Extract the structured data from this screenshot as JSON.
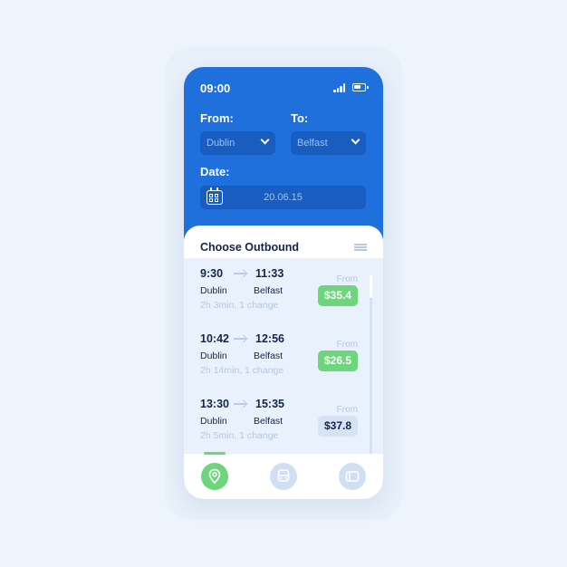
{
  "status_bar": {
    "time": "09:00"
  },
  "search": {
    "from_label": "From:",
    "from_value": "Dublin",
    "to_label": "To:",
    "to_value": "Belfast",
    "date_label": "Date:",
    "date_value": "20.06.15"
  },
  "results": {
    "title": "Choose Outbound",
    "trips": [
      {
        "depart": "9:30",
        "arrive": "11:33",
        "from": "Dublin",
        "to": "Belfast",
        "duration": "2h 3min, 1 change",
        "from_label": "From",
        "price": "$35.4",
        "style": "green"
      },
      {
        "depart": "10:42",
        "arrive": "12:56",
        "from": "Dublin",
        "to": "Belfast",
        "duration": "2h 14min, 1 change",
        "from_label": "From",
        "price": "$26.5",
        "style": "green"
      },
      {
        "depart": "13:30",
        "arrive": "15:35",
        "from": "Dublin",
        "to": "Belfast",
        "duration": "2h 5min, 1 change",
        "from_label": "From",
        "price": "$37.8",
        "style": "gray"
      }
    ]
  },
  "bottom_nav": [
    {
      "icon": "location-pin-icon",
      "active": true
    },
    {
      "icon": "train-icon",
      "active": false
    },
    {
      "icon": "ticket-icon",
      "active": false
    }
  ],
  "colors": {
    "primary": "#1f6fdc",
    "accent": "#6fd57c",
    "text": "#14254a",
    "muted": "#b6c8e2"
  }
}
